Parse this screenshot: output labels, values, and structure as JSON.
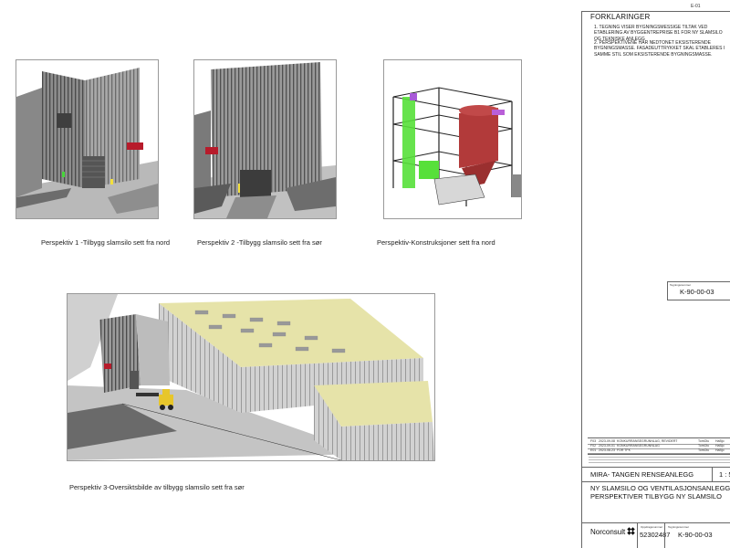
{
  "sheet_label": "E-01",
  "notes": {
    "title": "FORKLARINGER",
    "items": [
      "1.   TEGNING VISER BYGNINGSMESSIGE TILTAK VED ETABLERING AV BYGGENTREPRISE B1 FOR NY SLAMSILO OG TEKNISKE ANLEGG",
      "2.   PERSPEKTIVENE HAR NEDTONET EKSISTERENDE BYGNINGSMASSE. FASADEUTTRYKKET SKAL ETABLERES I SAMME STIL SOM EKSISTERENDE BYGNINGSMASSE."
    ]
  },
  "views": [
    {
      "caption": "Perspektiv 1 -Tilbygg slamsilo sett fra nord"
    },
    {
      "caption": "Perspektiv 2 -Tilbygg slamsilo sett fra sør"
    },
    {
      "caption": "Perspektiv-Konstruksjoner sett fra nord"
    },
    {
      "caption": "Perspektiv 3-Oversiktsbilde av tilbygg slamsilo sett fra sør"
    }
  ],
  "side_ref": {
    "label": "Tegningsnummer",
    "number": "K-90-00-03"
  },
  "revisions": {
    "rows": [
      {
        "rev": "F03",
        "date": "2023-09-08",
        "text": "KONKURRANSEGRUNNLAG, REVIDERT",
        "drawn": "TomOlu",
        "checked": "HaBjo"
      },
      {
        "rev": "F02",
        "date": "2023-09-01",
        "text": "KONKURRANSEGRUNNLAG",
        "drawn": "TomOlu",
        "checked": "HaBjo"
      },
      {
        "rev": "E01",
        "date": "2023-08-23",
        "text": "FOR TFK",
        "drawn": "TomOlu",
        "checked": "HaBjo"
      }
    ]
  },
  "title_block": {
    "project": "MIRA- TANGEN RENSEANLEGG",
    "scale": "1 : 5",
    "drawing_title_1": "NY SLAMSILO OG VENTILASJONSANLEGG",
    "drawing_title_2": "PERSPEKTIVER TILBYGG NY SLAMSILO",
    "company": "Norconsult",
    "assignment_no": "52302487",
    "drawing_no": "K-90-00-03",
    "label_assignment": "Oppdragsnummer",
    "label_drawing": "Tegningsnummer"
  }
}
